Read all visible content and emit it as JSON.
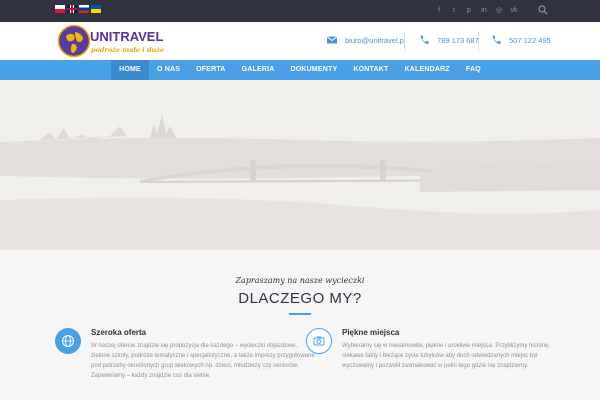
{
  "topbar": {
    "languages": [
      {
        "name": "flag-pl-icon"
      },
      {
        "name": "flag-gb-icon"
      },
      {
        "name": "flag-ru-icon"
      },
      {
        "name": "flag-ua-icon"
      }
    ],
    "social_icons": [
      {
        "name": "facebook-icon",
        "glyph": "f"
      },
      {
        "name": "twitter-icon",
        "glyph": "t"
      },
      {
        "name": "pinterest-icon",
        "glyph": "p"
      },
      {
        "name": "linkedin-icon",
        "glyph": "in"
      },
      {
        "name": "instagram-icon",
        "glyph": "◎"
      },
      {
        "name": "vk-icon",
        "glyph": "vk"
      }
    ],
    "search_icon": "search-icon"
  },
  "header": {
    "logo_name": "UNITRAVEL",
    "logo_tagline": "podróże małe i duże",
    "email": "biuro@unitravel.pl",
    "phone1": "789 173 687",
    "phone2": "507 122 495"
  },
  "nav": {
    "items": [
      {
        "label": "HOME",
        "active": true
      },
      {
        "label": "O NAS",
        "active": false
      },
      {
        "label": "OFERTA",
        "active": false
      },
      {
        "label": "GALERIA",
        "active": false
      },
      {
        "label": "DOKUMENTY",
        "active": false
      },
      {
        "label": "KONTAKT",
        "active": false
      },
      {
        "label": "KALENDARZ",
        "active": false
      },
      {
        "label": "FAQ",
        "active": false
      }
    ]
  },
  "section": {
    "subtitle": "Zapraszamy na nasze wycieczki",
    "heading": "DLACZEGO MY?"
  },
  "features": [
    {
      "icon": "globe-icon",
      "title": "Szeroka oferta",
      "text": "W naszej ofercie znajdzie się propozycja dla każdego – wycieczki objazdowe, zielone szkoły, podróże tematyczne i specjalistyczne, a także imprezy przygotowane pod potrzeby określonych grup wiekowych np. dzieci, młodzieży czy seniorów. Zapewniamy – każdy znajdzie coś dla siebie."
    },
    {
      "icon": "camera-icon",
      "title": "Piękne miejsca",
      "text": "Wybieramy się w niesamowite, piękne i urokliwe miejsca. Przybliżymy historię, ciekawe fakty i bieżące życie tubylców aby duch odwiedzanych miejsc był wyczuwalny i pozwolił zasmakować w pełni tego gdzie się znajdziemy."
    }
  ],
  "colors": {
    "accent": "#4aa0e6",
    "topbar": "#2f3440",
    "heading": "#2c3441"
  }
}
